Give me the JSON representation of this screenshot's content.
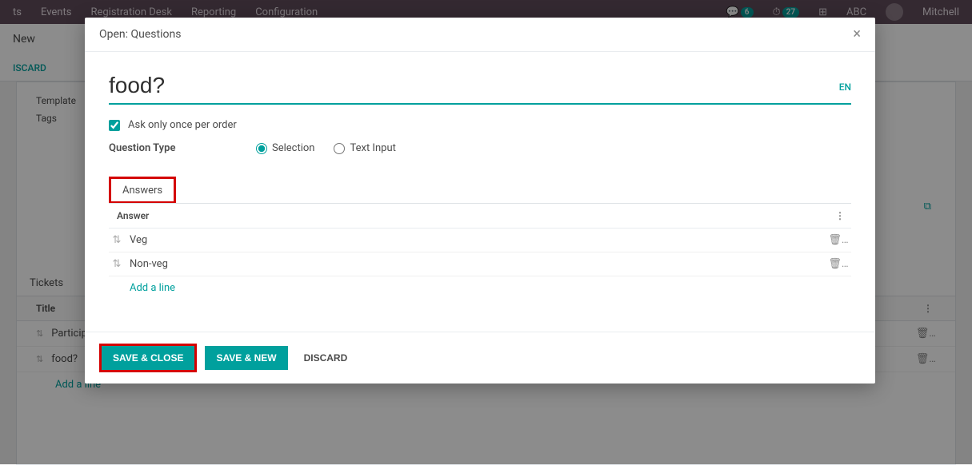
{
  "nav": {
    "app": "ts",
    "items": [
      "Events",
      "Registration Desk",
      "Reporting",
      "Configuration"
    ],
    "notif1": "6",
    "notif2": "27",
    "user_initials": "ABC",
    "user_name": "Mitchell"
  },
  "crumb": {
    "new": "New",
    "discard": "ISCARD"
  },
  "bg": {
    "row_template": "Template",
    "row_tags": "Tags",
    "tab_tickets": "Tickets",
    "col_title": "Title",
    "rows": [
      "Participa",
      "food?"
    ],
    "add_line": "Add a line"
  },
  "modal": {
    "title": "Open: Questions",
    "question": "food?",
    "lang": "EN",
    "ask_once_label": "Ask only once per order",
    "qtype_label": "Question Type",
    "qtype_selection": "Selection",
    "qtype_text": "Text Input",
    "answers_tab": "Answers",
    "answer_header": "Answer",
    "answers": [
      "Veg",
      "Non-veg"
    ],
    "add_line": "Add a line",
    "save_close": "SAVE & CLOSE",
    "save_new": "SAVE & NEW",
    "discard": "DISCARD"
  }
}
